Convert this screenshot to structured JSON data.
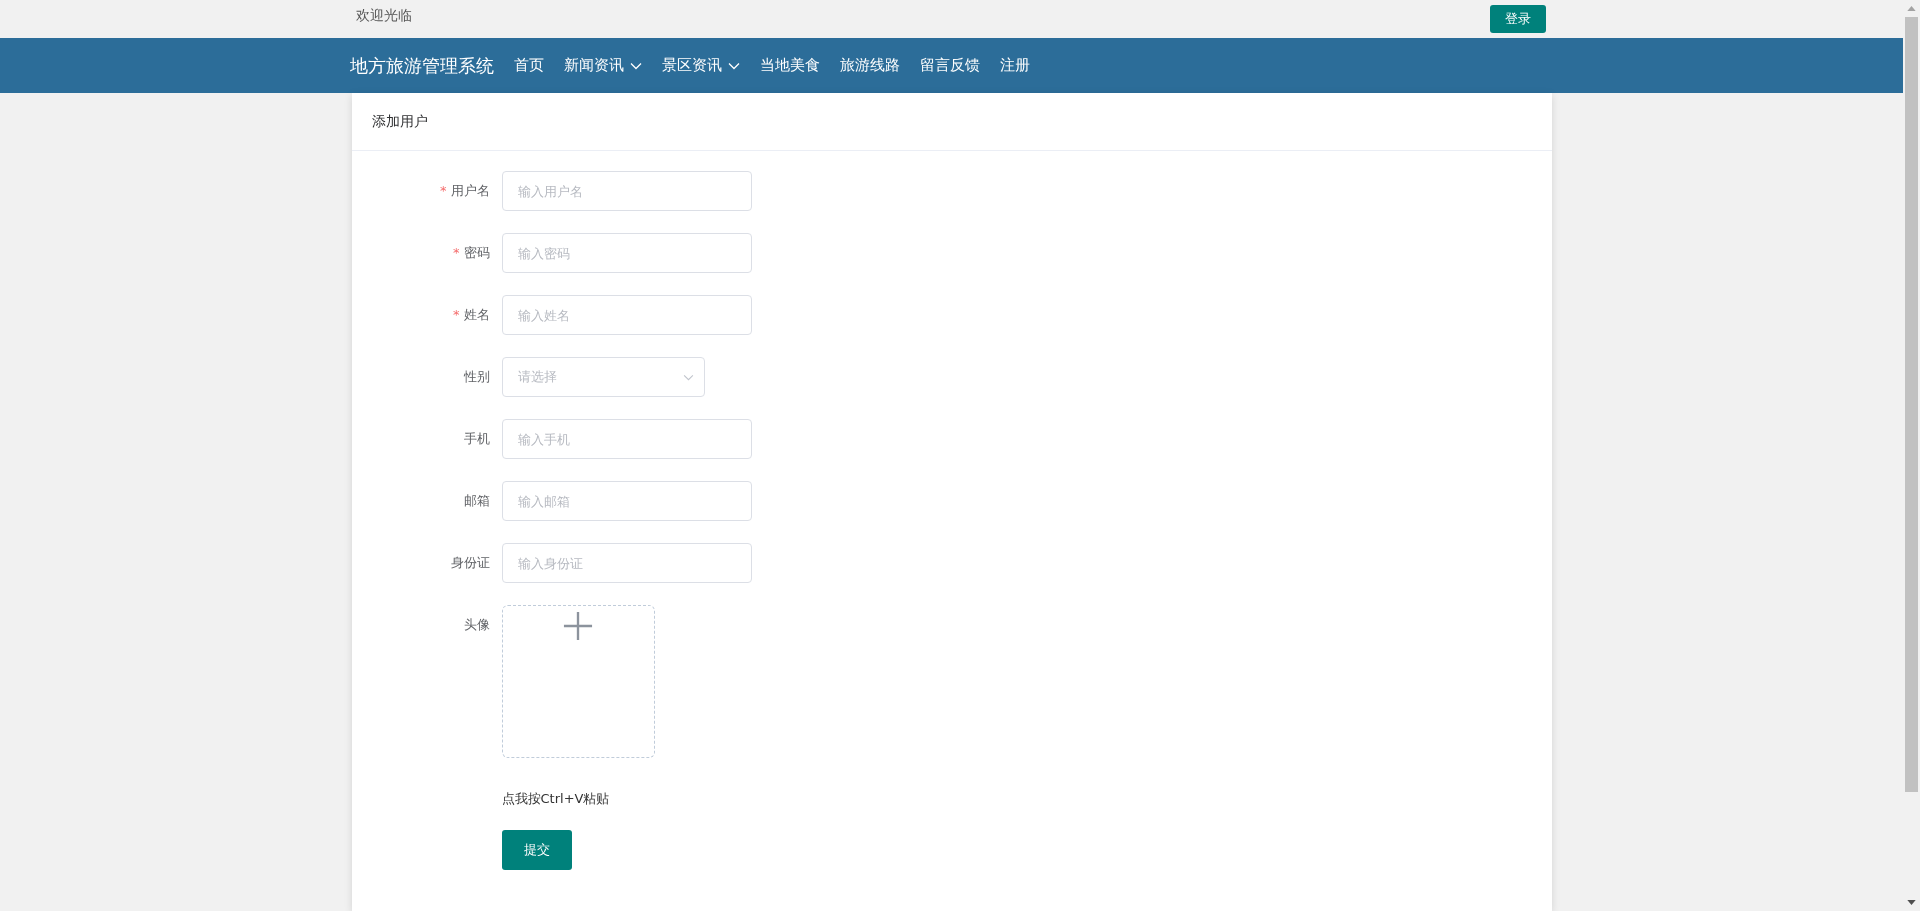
{
  "top_bar": {
    "welcome": "欢迎光临",
    "login_button": "登录"
  },
  "nav": {
    "brand": "地方旅游管理系统",
    "items": [
      {
        "label": "首页",
        "has_dropdown": false
      },
      {
        "label": "新闻资讯",
        "has_dropdown": true
      },
      {
        "label": "景区资讯",
        "has_dropdown": true
      },
      {
        "label": "当地美食",
        "has_dropdown": false
      },
      {
        "label": "旅游线路",
        "has_dropdown": false
      },
      {
        "label": "留言反馈",
        "has_dropdown": false
      },
      {
        "label": "注册",
        "has_dropdown": false
      }
    ]
  },
  "card": {
    "title": "添加用户",
    "form": {
      "fields": [
        {
          "kind": "input",
          "label": "用户名",
          "required": true,
          "placeholder": "输入用户名"
        },
        {
          "kind": "input",
          "label": "密码",
          "required": true,
          "placeholder": "输入密码"
        },
        {
          "kind": "input",
          "label": "姓名",
          "required": true,
          "placeholder": "输入姓名"
        },
        {
          "kind": "select",
          "label": "性别",
          "required": false,
          "placeholder": "请选择"
        },
        {
          "kind": "input",
          "label": "手机",
          "required": false,
          "placeholder": "输入手机"
        },
        {
          "kind": "input",
          "label": "邮箱",
          "required": false,
          "placeholder": "输入邮箱"
        },
        {
          "kind": "input",
          "label": "身份证",
          "required": false,
          "placeholder": "输入身份证"
        },
        {
          "kind": "upload",
          "label": "头像",
          "required": false
        }
      ],
      "required_symbol": "*",
      "paste_hint": "点我按Ctrl+V粘贴",
      "submit_button": "提交"
    }
  }
}
